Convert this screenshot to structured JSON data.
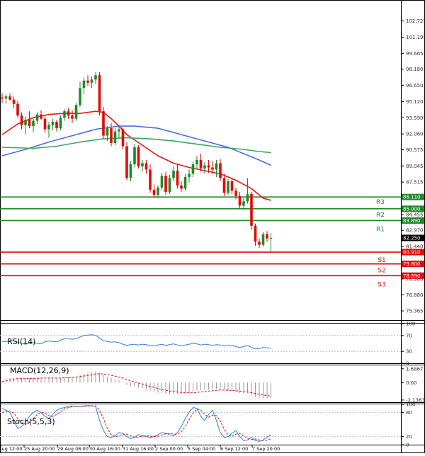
{
  "chart_data": [
    {
      "type": "candlestick",
      "panel": "price",
      "ylim": [
        74.5,
        104.5
      ],
      "y_ticks": [
        "102.725",
        "101.195",
        "99.665",
        "98.180",
        "96.650",
        "95.120",
        "93.590",
        "92.060",
        "90.575",
        "89.045",
        "87.515",
        "85.985",
        "84.455",
        "82.970",
        "81.440",
        "79.910",
        "78.380",
        "76.880",
        "75.365"
      ],
      "candles": [
        {
          "o": 95.5,
          "h": 95.9,
          "l": 95.0,
          "c": 95.4
        },
        {
          "o": 95.4,
          "h": 95.8,
          "l": 94.9,
          "c": 95.6
        },
        {
          "o": 95.6,
          "h": 95.9,
          "l": 95.2,
          "c": 95.3
        },
        {
          "o": 95.3,
          "h": 95.6,
          "l": 94.5,
          "c": 94.9
        },
        {
          "o": 94.9,
          "h": 95.2,
          "l": 93.6,
          "c": 93.8
        },
        {
          "o": 93.8,
          "h": 94.1,
          "l": 92.5,
          "c": 92.9
        },
        {
          "o": 92.9,
          "h": 93.7,
          "l": 92.0,
          "c": 93.4
        },
        {
          "o": 93.4,
          "h": 94.2,
          "l": 92.6,
          "c": 92.8
        },
        {
          "o": 92.8,
          "h": 93.5,
          "l": 92.2,
          "c": 93.3
        },
        {
          "o": 93.3,
          "h": 94.1,
          "l": 93.0,
          "c": 93.9
        },
        {
          "o": 93.9,
          "h": 94.3,
          "l": 93.4,
          "c": 93.5
        },
        {
          "o": 93.5,
          "h": 93.8,
          "l": 92.2,
          "c": 92.5
        },
        {
          "o": 92.5,
          "h": 93.2,
          "l": 91.7,
          "c": 92.9
        },
        {
          "o": 92.9,
          "h": 93.5,
          "l": 92.4,
          "c": 93.2
        },
        {
          "o": 93.2,
          "h": 93.4,
          "l": 92.3,
          "c": 92.6
        },
        {
          "o": 92.6,
          "h": 93.8,
          "l": 92.4,
          "c": 93.6
        },
        {
          "o": 93.6,
          "h": 94.4,
          "l": 93.3,
          "c": 94.2
        },
        {
          "o": 94.2,
          "h": 94.5,
          "l": 93.5,
          "c": 93.8
        },
        {
          "o": 93.8,
          "h": 94.3,
          "l": 93.1,
          "c": 93.5
        },
        {
          "o": 93.5,
          "h": 95.0,
          "l": 93.3,
          "c": 94.8
        },
        {
          "o": 94.8,
          "h": 97.0,
          "l": 94.6,
          "c": 96.4
        },
        {
          "o": 96.4,
          "h": 97.4,
          "l": 95.8,
          "c": 97.1
        },
        {
          "o": 97.1,
          "h": 97.6,
          "l": 96.6,
          "c": 96.9
        },
        {
          "o": 96.9,
          "h": 97.5,
          "l": 96.4,
          "c": 97.2
        },
        {
          "o": 97.2,
          "h": 97.9,
          "l": 96.8,
          "c": 97.6
        },
        {
          "o": 97.6,
          "h": 97.9,
          "l": 93.8,
          "c": 94.2
        },
        {
          "o": 94.2,
          "h": 94.6,
          "l": 91.6,
          "c": 91.9
        },
        {
          "o": 91.9,
          "h": 92.8,
          "l": 91.4,
          "c": 92.6
        },
        {
          "o": 92.6,
          "h": 93.1,
          "l": 90.9,
          "c": 91.2
        },
        {
          "o": 91.2,
          "h": 92.6,
          "l": 91.0,
          "c": 92.3
        },
        {
          "o": 92.3,
          "h": 92.8,
          "l": 91.7,
          "c": 92.5
        },
        {
          "o": 92.5,
          "h": 92.7,
          "l": 90.6,
          "c": 90.9
        },
        {
          "o": 90.9,
          "h": 91.3,
          "l": 87.7,
          "c": 87.9
        },
        {
          "o": 87.9,
          "h": 89.5,
          "l": 87.6,
          "c": 89.2
        },
        {
          "o": 89.2,
          "h": 91.1,
          "l": 88.9,
          "c": 90.8
        },
        {
          "o": 90.8,
          "h": 91.0,
          "l": 88.8,
          "c": 89.0
        },
        {
          "o": 89.0,
          "h": 89.6,
          "l": 88.5,
          "c": 89.3
        },
        {
          "o": 89.3,
          "h": 89.6,
          "l": 88.3,
          "c": 88.7
        },
        {
          "o": 88.7,
          "h": 89.2,
          "l": 86.5,
          "c": 86.8
        },
        {
          "o": 86.8,
          "h": 87.3,
          "l": 86.0,
          "c": 86.3
        },
        {
          "o": 86.3,
          "h": 87.2,
          "l": 86.0,
          "c": 87.0
        },
        {
          "o": 87.0,
          "h": 88.4,
          "l": 86.8,
          "c": 88.1
        },
        {
          "o": 88.1,
          "h": 88.5,
          "l": 86.3,
          "c": 86.6
        },
        {
          "o": 86.6,
          "h": 88.2,
          "l": 86.4,
          "c": 87.9
        },
        {
          "o": 87.9,
          "h": 89.0,
          "l": 87.6,
          "c": 88.6
        },
        {
          "o": 88.6,
          "h": 89.2,
          "l": 86.9,
          "c": 87.2
        },
        {
          "o": 87.2,
          "h": 87.6,
          "l": 86.6,
          "c": 86.9
        },
        {
          "o": 86.9,
          "h": 88.3,
          "l": 86.7,
          "c": 88.0
        },
        {
          "o": 88.0,
          "h": 88.7,
          "l": 87.5,
          "c": 88.3
        },
        {
          "o": 88.3,
          "h": 89.5,
          "l": 88.0,
          "c": 89.2
        },
        {
          "o": 89.2,
          "h": 90.0,
          "l": 88.8,
          "c": 89.6
        },
        {
          "o": 89.6,
          "h": 90.2,
          "l": 88.5,
          "c": 88.8
        },
        {
          "o": 88.8,
          "h": 89.4,
          "l": 88.3,
          "c": 89.1
        },
        {
          "o": 89.1,
          "h": 89.6,
          "l": 88.4,
          "c": 88.9
        },
        {
          "o": 88.9,
          "h": 89.5,
          "l": 88.3,
          "c": 88.7
        },
        {
          "o": 88.7,
          "h": 89.6,
          "l": 88.0,
          "c": 89.3
        },
        {
          "o": 89.3,
          "h": 89.7,
          "l": 87.6,
          "c": 87.9
        },
        {
          "o": 87.9,
          "h": 88.3,
          "l": 86.2,
          "c": 86.5
        },
        {
          "o": 86.5,
          "h": 87.8,
          "l": 86.3,
          "c": 87.6
        },
        {
          "o": 87.6,
          "h": 87.9,
          "l": 86.4,
          "c": 86.7
        },
        {
          "o": 86.7,
          "h": 87.0,
          "l": 85.9,
          "c": 86.2
        },
        {
          "o": 86.2,
          "h": 86.6,
          "l": 85.0,
          "c": 85.3
        },
        {
          "o": 85.3,
          "h": 86.0,
          "l": 84.9,
          "c": 85.7
        },
        {
          "o": 85.7,
          "h": 87.9,
          "l": 85.5,
          "c": 86.4
        },
        {
          "o": 86.4,
          "h": 86.6,
          "l": 83.0,
          "c": 83.4
        },
        {
          "o": 83.4,
          "h": 83.6,
          "l": 81.5,
          "c": 81.9
        },
        {
          "o": 81.9,
          "h": 82.2,
          "l": 81.3,
          "c": 81.6
        },
        {
          "o": 81.6,
          "h": 82.8,
          "l": 81.4,
          "c": 82.6
        },
        {
          "o": 82.6,
          "h": 82.9,
          "l": 81.9,
          "c": 82.2
        },
        {
          "o": 82.2,
          "h": 82.7,
          "l": 81.0,
          "c": 82.25
        }
      ],
      "moving_averages": [
        {
          "color": "#e8180e",
          "values": [
            [
              0,
              92.0
            ],
            [
              4,
              93.0
            ],
            [
              8,
              93.6
            ],
            [
              12,
              93.9
            ],
            [
              16,
              94.0
            ],
            [
              20,
              94.0
            ],
            [
              24,
              94.2
            ],
            [
              26,
              94.1
            ],
            [
              28,
              93.5
            ],
            [
              30,
              92.8
            ],
            [
              32,
              92.0
            ],
            [
              36,
              91.0
            ],
            [
              40,
              90.0
            ],
            [
              44,
              89.3
            ],
            [
              48,
              88.9
            ],
            [
              52,
              88.6
            ],
            [
              56,
              88.3
            ],
            [
              60,
              87.7
            ],
            [
              64,
              86.9
            ],
            [
              67,
              86.0
            ],
            [
              69,
              85.8
            ]
          ]
        },
        {
          "color": "#4a6ee0",
          "values": [
            [
              0,
              90.0
            ],
            [
              6,
              90.6
            ],
            [
              12,
              91.3
            ],
            [
              18,
              91.9
            ],
            [
              24,
              92.5
            ],
            [
              30,
              92.8
            ],
            [
              34,
              92.8
            ],
            [
              40,
              92.6
            ],
            [
              46,
              92.0
            ],
            [
              52,
              91.4
            ],
            [
              58,
              90.8
            ],
            [
              62,
              90.2
            ],
            [
              66,
              89.6
            ],
            [
              69,
              89.1
            ]
          ]
        },
        {
          "color": "#38a85a",
          "values": [
            [
              0,
              90.8
            ],
            [
              8,
              90.7
            ],
            [
              14,
              90.9
            ],
            [
              20,
              91.3
            ],
            [
              26,
              91.6
            ],
            [
              32,
              91.7
            ],
            [
              38,
              91.6
            ],
            [
              44,
              91.4
            ],
            [
              50,
              91.1
            ],
            [
              56,
              90.8
            ],
            [
              62,
              90.6
            ],
            [
              66,
              90.4
            ],
            [
              69,
              90.3
            ]
          ]
        }
      ],
      "last_price": {
        "value": 82.25,
        "label": "82.250"
      },
      "resistance": [
        {
          "name": "R3",
          "value": 86.11,
          "label": "86.110"
        },
        {
          "name": "R2",
          "value": 85.0,
          "label": "85.000"
        },
        {
          "name": "R1",
          "value": 83.89,
          "label": "83.890"
        }
      ],
      "support": [
        {
          "name": "S1",
          "value": 80.91,
          "label": "80.910"
        },
        {
          "name": "S2",
          "value": 79.8,
          "label": "79.800"
        },
        {
          "name": "S3",
          "value": 78.69,
          "label": "78.690"
        }
      ],
      "colors": {
        "resistance": "#1f8a2a",
        "support": "#e20a0a",
        "bull": "#1f8a2a",
        "bear": "#e20a0a",
        "last_price_bg": "#000000"
      }
    },
    {
      "type": "line",
      "panel": "rsi",
      "title": "RSI(14)",
      "ylim": [
        0,
        100
      ],
      "y_ticks": [
        "100",
        "70",
        "30",
        "0"
      ],
      "color": "#2f7fe0",
      "values": [
        55,
        54,
        57,
        56,
        53,
        50,
        48,
        50,
        52,
        50,
        49,
        54,
        56,
        55,
        54,
        58,
        62,
        63,
        60,
        62,
        66,
        70,
        71,
        72,
        70,
        64,
        57,
        55,
        53,
        54,
        52,
        48,
        45,
        47,
        48,
        46,
        48,
        47,
        45,
        44,
        46,
        48,
        45,
        47,
        49,
        46,
        44,
        46,
        48,
        50,
        49,
        46,
        48,
        47,
        45,
        47,
        46,
        43,
        46,
        45,
        42,
        40,
        42,
        45,
        40,
        36,
        37,
        40,
        39,
        38
      ]
    },
    {
      "type": "bar+line",
      "panel": "macd",
      "title": "MACD(12,26,9)",
      "ylim": [
        -2.4,
        2.1
      ],
      "y_ticks": [
        "1.6867",
        "0.00",
        "-2.1363"
      ],
      "bar_color": "#9a9a9a",
      "signal_color": "#e01010",
      "histogram": [
        0.2,
        0.4,
        0.5,
        0.6,
        0.6,
        0.55,
        0.5,
        0.5,
        0.55,
        0.6,
        0.6,
        0.55,
        0.55,
        0.55,
        0.5,
        0.55,
        0.65,
        0.7,
        0.7,
        0.75,
        0.9,
        1.05,
        1.2,
        1.3,
        1.4,
        1.2,
        0.9,
        0.7,
        0.55,
        0.4,
        0.25,
        0.05,
        -0.3,
        -0.45,
        -0.5,
        -0.6,
        -0.7,
        -0.85,
        -1.0,
        -1.15,
        -1.25,
        -1.3,
        -1.35,
        -1.4,
        -1.35,
        -1.4,
        -1.45,
        -1.4,
        -1.3,
        -1.15,
        -1.0,
        -0.95,
        -0.9,
        -0.85,
        -0.8,
        -0.75,
        -0.8,
        -0.95,
        -1.0,
        -1.05,
        -1.15,
        -1.3,
        -1.35,
        -1.3,
        -1.55,
        -1.75,
        -1.85,
        -1.9,
        -1.9,
        -1.95
      ],
      "signal": [
        0.1,
        0.2,
        0.3,
        0.4,
        0.5,
        0.52,
        0.52,
        0.5,
        0.5,
        0.52,
        0.55,
        0.56,
        0.56,
        0.56,
        0.55,
        0.55,
        0.58,
        0.61,
        0.64,
        0.67,
        0.73,
        0.8,
        0.88,
        0.96,
        1.05,
        1.08,
        1.04,
        0.97,
        0.88,
        0.78,
        0.67,
        0.55,
        0.38,
        0.22,
        0.08,
        -0.05,
        -0.18,
        -0.32,
        -0.46,
        -0.6,
        -0.73,
        -0.85,
        -0.95,
        -1.04,
        -1.1,
        -1.16,
        -1.21,
        -1.25,
        -1.26,
        -1.24,
        -1.2,
        -1.15,
        -1.1,
        -1.05,
        -1.0,
        -0.95,
        -0.92,
        -0.92,
        -0.94,
        -0.96,
        -1.0,
        -1.06,
        -1.12,
        -1.15,
        -1.23,
        -1.33,
        -1.43,
        -1.52,
        -1.6,
        -1.66
      ]
    },
    {
      "type": "line",
      "panel": "stoch",
      "title": "Stoch(5,5,3)",
      "ylim": [
        0,
        100
      ],
      "y_ticks": [
        "100",
        "80",
        "20",
        "0"
      ],
      "series": [
        {
          "color": "#2f7fe0",
          "values": [
            90,
            85,
            80,
            60,
            40,
            45,
            55,
            70,
            80,
            85,
            80,
            70,
            65,
            75,
            85,
            90,
            92,
            95,
            96,
            94,
            95,
            96,
            97,
            96,
            95,
            60,
            35,
            20,
            18,
            22,
            30,
            28,
            20,
            15,
            18,
            25,
            22,
            20,
            18,
            20,
            25,
            30,
            28,
            25,
            22,
            30,
            45,
            65,
            80,
            92,
            90,
            70,
            60,
            75,
            85,
            60,
            30,
            18,
            20,
            28,
            35,
            20,
            10,
            12,
            18,
            10,
            8,
            12,
            18,
            25
          ]
        },
        {
          "color": "#e01010",
          "values": [
            80,
            82,
            84,
            78,
            65,
            55,
            50,
            55,
            65,
            75,
            80,
            78,
            72,
            70,
            75,
            82,
            88,
            92,
            94,
            95,
            95,
            95,
            96,
            96,
            96,
            85,
            65,
            40,
            25,
            20,
            22,
            26,
            26,
            22,
            18,
            19,
            21,
            22,
            21,
            20,
            21,
            24,
            27,
            28,
            26,
            26,
            32,
            45,
            62,
            78,
            88,
            86,
            75,
            68,
            73,
            72,
            58,
            38,
            24,
            21,
            26,
            28,
            22,
            15,
            13,
            14,
            12,
            10,
            11,
            15
          ]
        }
      ]
    }
  ],
  "x_ticks": [
    "Aug 12:00",
    "25 Aug 20:00",
    "29 Aug 08:00",
    "30 Aug 16:00",
    "31 Aug 16:00",
    "2 Sep 00:00",
    "5 Sep 04:00",
    "6 Sep 12:00",
    "7 Sep 20:00"
  ]
}
